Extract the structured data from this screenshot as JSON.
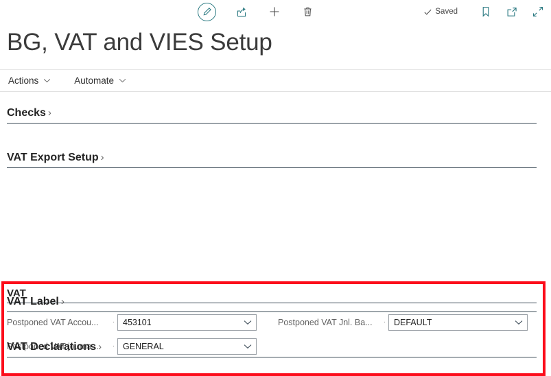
{
  "command_bar": {
    "left_icons": [
      {
        "name": "edit-pencil-icon",
        "label": "Edit"
      },
      {
        "name": "share-icon",
        "label": "Share"
      },
      {
        "name": "plus-icon",
        "label": "New"
      },
      {
        "name": "trash-icon",
        "label": "Delete"
      }
    ],
    "saved_label": "Saved",
    "right_icons": [
      {
        "name": "bookmark-icon",
        "label": "Bookmark"
      },
      {
        "name": "open-in-new-window-icon",
        "label": "Open in new window"
      },
      {
        "name": "expand-fullscreen-icon",
        "label": "Expand"
      }
    ]
  },
  "header": {
    "title": "BG, VAT and VIES Setup"
  },
  "actions_bar": {
    "items": [
      {
        "label": "Actions"
      },
      {
        "label": "Automate"
      }
    ],
    "caret_icon": "chevron-down-icon"
  },
  "sections": [
    {
      "label": "Checks",
      "chevron": "›"
    },
    {
      "label": "VAT Export Setup",
      "chevron": "›"
    },
    {
      "label": "VAT Label",
      "chevron": "›"
    },
    {
      "label": "VAT Declarations",
      "chevron": "›"
    }
  ],
  "vat_group": {
    "title": "VAT",
    "separator": "·",
    "fields_left": [
      {
        "label": "Postponed VAT Accou...",
        "value": "453101",
        "dropdown_icon": "chevron-down-icon"
      },
      {
        "label": "Postponed VAT journa...",
        "value": "GENERAL",
        "dropdown_icon": "chevron-down-icon"
      }
    ],
    "fields_right": [
      {
        "label": "Postponed VAT Jnl. Ba...",
        "value": "DEFAULT",
        "dropdown_icon": "chevron-down-icon"
      }
    ]
  },
  "colors": {
    "highlight_box": "#fc0d1b",
    "accent_teal": "#2b7a82",
    "section_rule": "#3b4a56"
  }
}
